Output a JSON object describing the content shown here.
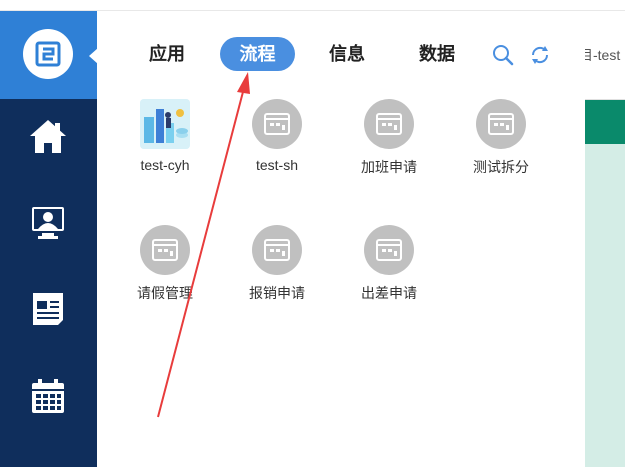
{
  "background_app": {
    "partial_title": "目-test"
  },
  "sidebar": {
    "logo_icon": "app-logo-icon",
    "items": [
      {
        "name": "home",
        "icon": "home-icon"
      },
      {
        "name": "monitor",
        "icon": "user-monitor-icon"
      },
      {
        "name": "news",
        "icon": "document-icon"
      },
      {
        "name": "calendar",
        "icon": "calendar-icon"
      }
    ]
  },
  "panel": {
    "tabs": [
      {
        "label": "应用",
        "active": false
      },
      {
        "label": "流程",
        "active": true
      },
      {
        "label": "信息",
        "active": false
      },
      {
        "label": "数据",
        "active": false
      }
    ],
    "tools": [
      {
        "icon": "search-icon"
      },
      {
        "icon": "refresh-icon"
      }
    ],
    "apps": [
      {
        "label": "test-cyh",
        "icon": "custom-image-icon"
      },
      {
        "label": "test-sh",
        "icon": "app-placeholder-icon"
      },
      {
        "label": "加班申请",
        "icon": "app-placeholder-icon"
      },
      {
        "label": "测试拆分",
        "icon": "app-placeholder-icon"
      },
      {
        "label": "请假管理",
        "icon": "app-placeholder-icon"
      },
      {
        "label": "报销申请",
        "icon": "app-placeholder-icon"
      },
      {
        "label": "出差申请",
        "icon": "app-placeholder-icon"
      }
    ]
  },
  "colors": {
    "rail": "#0f2e5c",
    "rail_logo": "#2f80d6",
    "active_tab": "#4a8fe0",
    "annotation_arrow": "#e83c3c",
    "icon_gray": "#c0c0c0"
  }
}
